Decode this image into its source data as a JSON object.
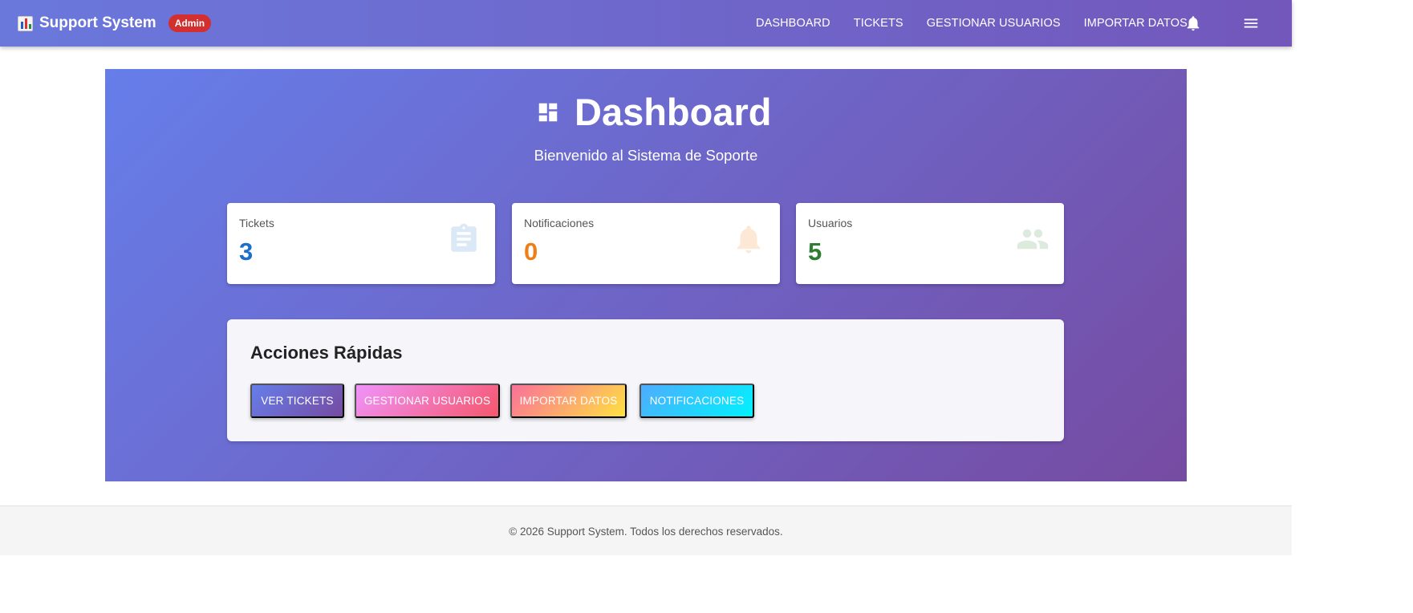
{
  "appbar": {
    "brand": "Support System",
    "brand_icon": "bar-chart-icon",
    "role_badge": "Admin",
    "nav": [
      "DASHBOARD",
      "TICKETS",
      "GESTIONAR USUARIOS",
      "IMPORTAR DATOS"
    ],
    "notifications_icon": "bell-icon",
    "menu_icon": "hamburger-menu-icon"
  },
  "hero": {
    "title": "Dashboard",
    "title_icon": "dashboard-icon",
    "subtitle": "Bienvenido al Sistema de Soporte"
  },
  "stats": [
    {
      "label": "Tickets",
      "value": "3",
      "icon": "clipboard-icon",
      "color": "#1e6fc9"
    },
    {
      "label": "Notificaciones",
      "value": "0",
      "icon": "bell-icon",
      "color": "#ef7f14"
    },
    {
      "label": "Usuarios",
      "value": "5",
      "icon": "users-icon",
      "color": "#2e7d32"
    }
  ],
  "quick_actions": {
    "title": "Acciones Rápidas",
    "buttons": [
      "VER TICKETS",
      "GESTIONAR USUARIOS",
      "IMPORTAR DATOS",
      "NOTIFICACIONES"
    ]
  },
  "footer": {
    "text": "© 2026 Support System. Todos los derechos reservados."
  },
  "colors": {
    "appbar_start": "#6a78dc",
    "appbar_end": "#7357bb",
    "hero_start": "#667eea",
    "hero_end": "#764ba2",
    "badge": "#d32f2f"
  }
}
